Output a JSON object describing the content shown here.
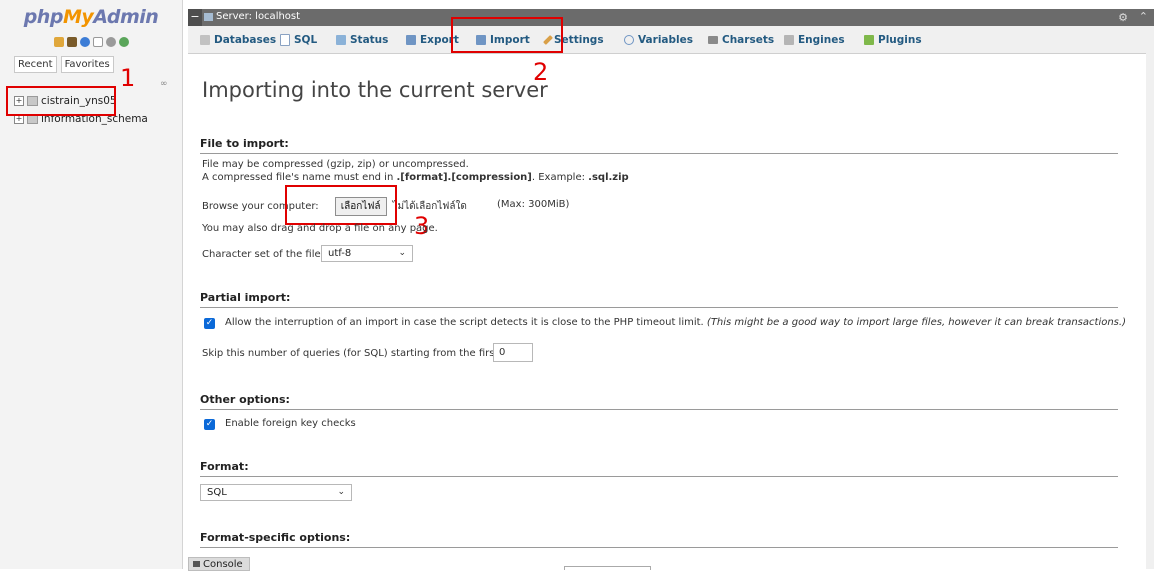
{
  "app": {
    "logo_php": "php",
    "logo_my": "My",
    "logo_admin": "Admin"
  },
  "nav": {
    "tabs": [
      "Recent",
      "Favorites"
    ],
    "databases": [
      "cistrain_yns05",
      "information_schema"
    ]
  },
  "annotations": {
    "one": "1",
    "two": "2",
    "three": "3",
    "color": "#e00000"
  },
  "server_bar": {
    "label": "Server: localhost",
    "collapse": "−"
  },
  "menu": {
    "tabs": [
      {
        "label": "Databases",
        "icon": "database-icon"
      },
      {
        "label": "SQL",
        "icon": "sql-icon"
      },
      {
        "label": "Status",
        "icon": "status-icon"
      },
      {
        "label": "Export",
        "icon": "export-icon"
      },
      {
        "label": "Import",
        "icon": "import-icon"
      },
      {
        "label": "Settings",
        "icon": "wrench-icon"
      },
      {
        "label": "Variables",
        "icon": "variables-icon"
      },
      {
        "label": "Charsets",
        "icon": "charsets-icon"
      },
      {
        "label": "Engines",
        "icon": "engines-icon"
      },
      {
        "label": "Plugins",
        "icon": "plugins-icon"
      }
    ]
  },
  "page": {
    "title": "Importing into the current server",
    "file_section": {
      "heading": "File to import:",
      "line1": "File may be compressed (gzip, zip) or uncompressed.",
      "line2_pre": "A compressed file's name must end in ",
      "line2_format": ".[format].[compression]",
      "line2_mid": ". Example: ",
      "line2_example": ".sql.zip",
      "browse_label": "Browse your computer:",
      "choose_file_button": "เลือกไฟล์",
      "no_file_text": "ไม่ได้เลือกไฟล์ใด",
      "max_size": "(Max: 300MiB)",
      "drag_hint": "You may also drag and drop a file on any page.",
      "charset_label": "Character set of the file:",
      "charset_value": "utf-8"
    },
    "partial_section": {
      "heading": "Partial import:",
      "allow_interrupt_label": "Allow the interruption of an import in case the script detects it is close to the PHP timeout limit.",
      "allow_interrupt_note": "(This might be a good way to import large files, however it can break transactions.)",
      "allow_interrupt_checked": true,
      "skip_label": "Skip this number of queries (for SQL) starting from the first one:",
      "skip_value": "0"
    },
    "other_section": {
      "heading": "Other options:",
      "fk_label": "Enable foreign key checks",
      "fk_checked": true
    },
    "format_section": {
      "heading": "Format:",
      "format_value": "SQL"
    },
    "format_specific_section": {
      "heading": "Format-specific options:"
    }
  },
  "console": {
    "label": "Console"
  }
}
